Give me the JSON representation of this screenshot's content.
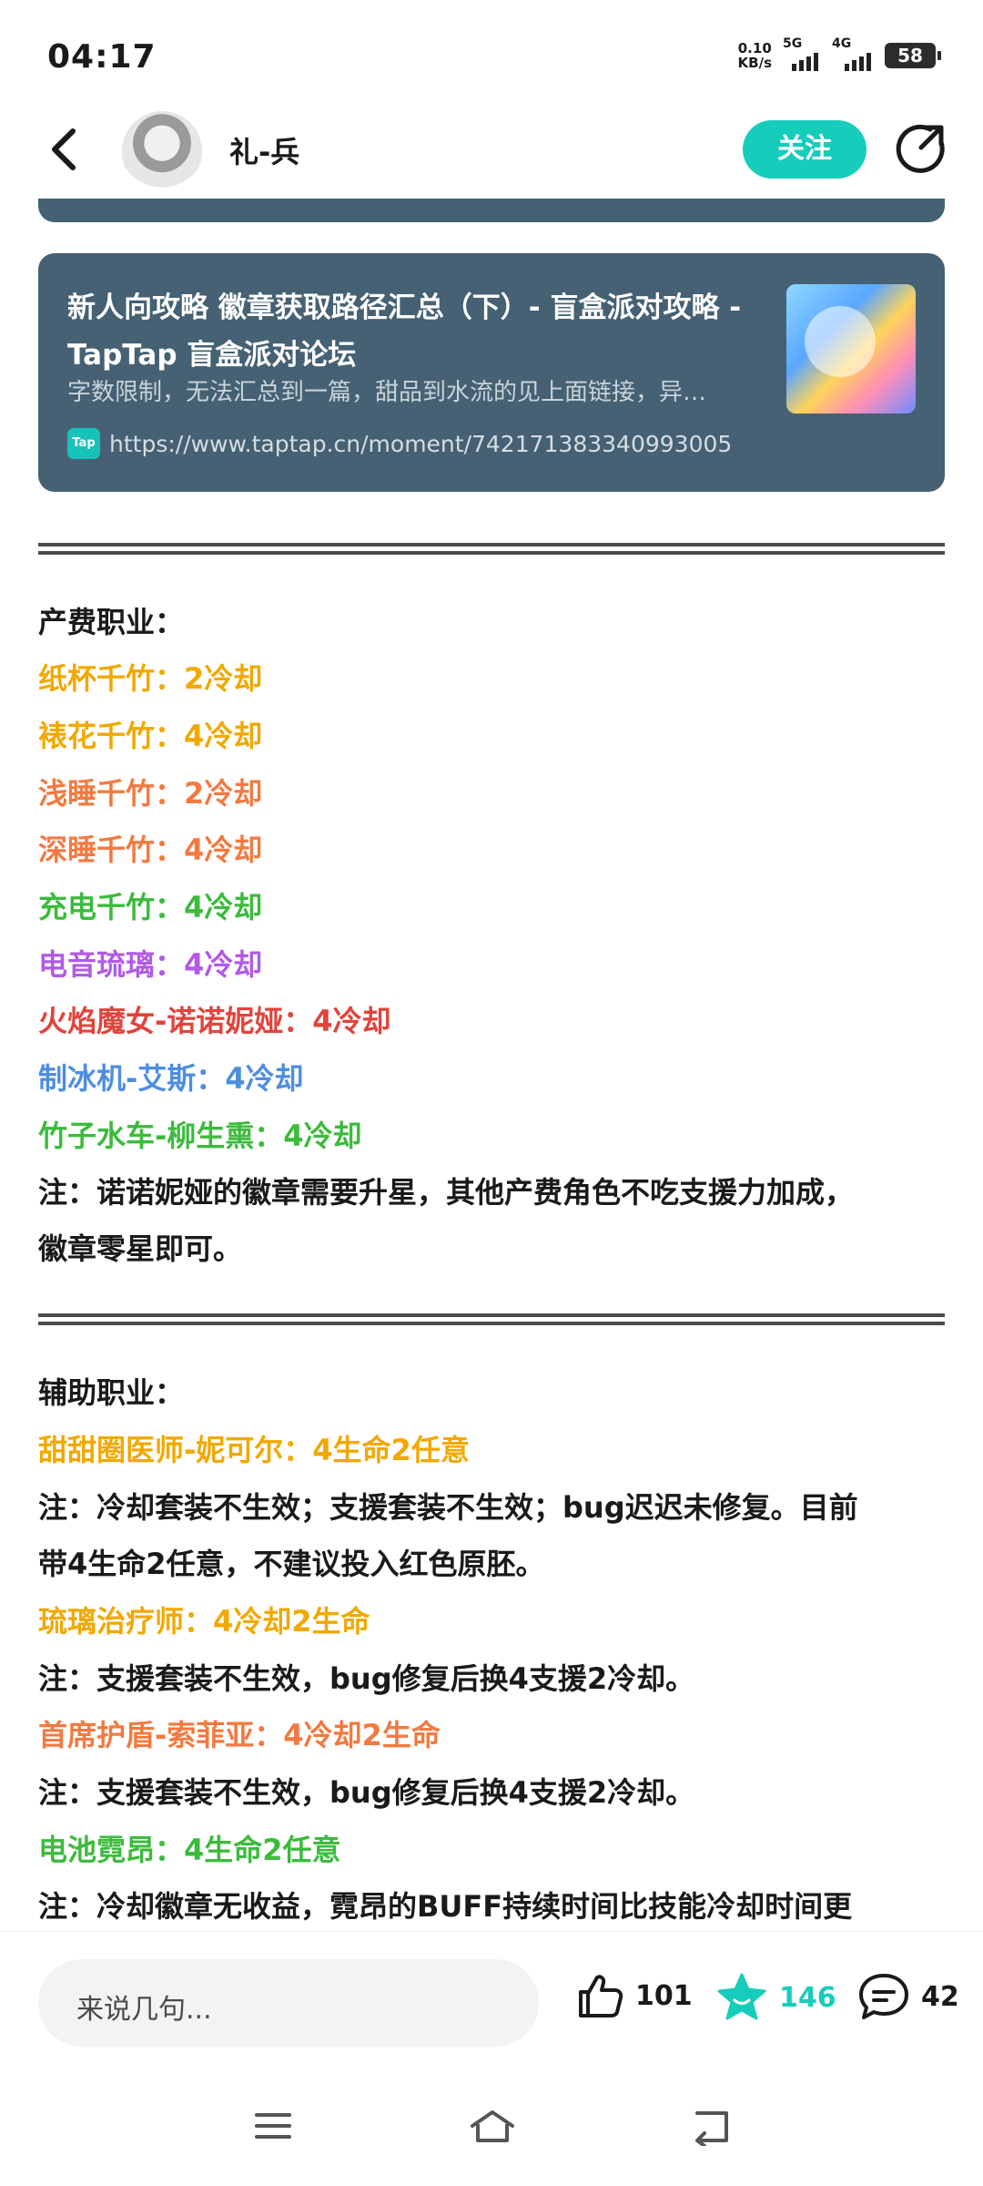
{
  "status": {
    "time": "04:17",
    "speed_value": "0.10",
    "speed_unit": "KB/s",
    "sig1": "5G",
    "sig2": "4G",
    "battery": "58"
  },
  "header": {
    "username": "礼-兵",
    "follow_label": "关注"
  },
  "link_card": {
    "title": "新人向攻略 徽章获取路径汇总（下）- 盲盒派对攻略 - TapTap 盲盒派对论坛",
    "description": "字数限制，无法汇总到一篇，甜品到水流的见上面链接，异…",
    "badge": "Tap",
    "url": "https://www.taptap.cn/moment/742171383340993005"
  },
  "article": {
    "sec1_heading": "产费职业：",
    "sec1_items": [
      "纸杯千竹：2冷却",
      "裱花千竹：4冷却",
      "浅睡千竹：2冷却",
      "深睡千竹：4冷却",
      "充电千竹：4冷却",
      "电音琉璃：4冷却",
      "火焰魔女-诺诺妮娅：4冷却",
      "制冰机-艾斯：4冷却",
      "竹子水车-柳生熏：4冷却"
    ],
    "sec1_note_1": "注：诺诺妮娅的徽章需要升星，其他产费角色不吃支援力加成，",
    "sec1_note_2": "徽章零星即可。",
    "sec2_heading": "辅助职业：",
    "sec2_item1": "甜甜圈医师-妮可尔：4生命2任意",
    "sec2_note1_1": "注：冷却套装不生效；支援套装不生效；bug迟迟未修复。目前",
    "sec2_note1_2": "带4生命2任意，不建议投入红色原胚。",
    "sec2_item2": "琉璃治疗师：4冷却2生命",
    "sec2_note2": "注：支援套装不生效，bug修复后换4支援2冷却。",
    "sec2_item3": "首席护盾-索菲亚：4冷却2生命",
    "sec2_note3": "注：支援套装不生效，bug修复后换4支援2冷却。",
    "sec2_item4": "电池霓昂：4生命2任意",
    "sec2_note4": "注：冷却徽章无收益，霓昂的BUFF持续时间比技能冷却时间更"
  },
  "bottom_bar": {
    "comment_placeholder": "来说几句...",
    "like_count": "101",
    "favorite_count": "146",
    "comment_count": "42"
  },
  "colors": {
    "accent": "#16cdbc",
    "card_bg": "#456173",
    "yellow": "#f1a800",
    "orange": "#f27a40",
    "green": "#3cbb3c",
    "purple": "#b25ae6",
    "red": "#e0443c",
    "blue": "#4d8ee0"
  },
  "icons": {
    "back": "chevron-left-icon",
    "share": "share-icon",
    "like": "thumbs-up-icon",
    "favorite": "star-icon",
    "comment": "comment-icon",
    "nav_menu": "menu-icon",
    "nav_home": "home-icon",
    "nav_back": "back-icon"
  }
}
